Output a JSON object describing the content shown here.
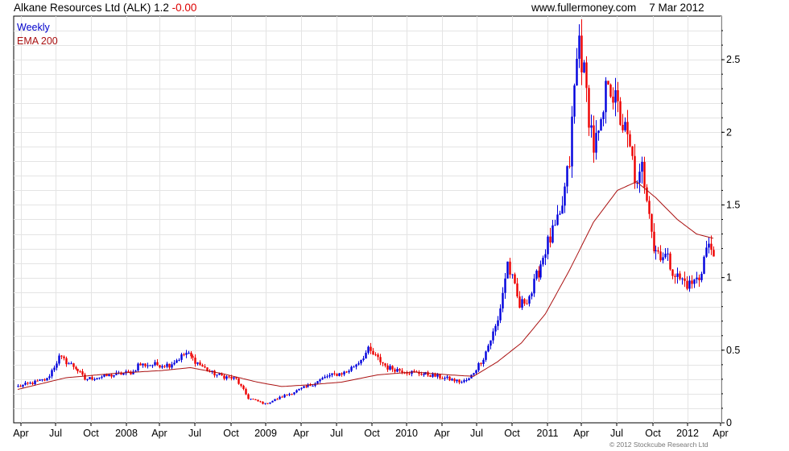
{
  "header": {
    "title": "Alkane Resources Ltd (ALK) 1.2",
    "change": "-0.00",
    "site": "www.fullermoney.com",
    "date": "7 Mar 2012"
  },
  "legend": {
    "weekly": "Weekly",
    "ema": "EMA 200"
  },
  "footer": "© 2012 Stockcube Research Ltd",
  "colors": {
    "up": "#0000dd",
    "down": "#ee0000",
    "ema": "#aa1111",
    "grid": "#e4e4e4"
  },
  "chart_data": {
    "type": "candlestick",
    "title": "Alkane Resources Ltd (ALK) 1.2 -0.00",
    "x_tick_labels": [
      "Apr",
      "Jul",
      "Oct",
      "2008",
      "Apr",
      "Jul",
      "Oct",
      "2009",
      "Apr",
      "Jul",
      "Oct",
      "2010",
      "Apr",
      "Jul",
      "Oct",
      "2011",
      "Apr",
      "Jul",
      "Oct",
      "2012",
      "Apr"
    ],
    "y_ticks": [
      0,
      0.5,
      1,
      1.5,
      2,
      2.5
    ],
    "ylim": [
      0,
      2.8
    ],
    "grid": true,
    "legend_position": "top-left",
    "series": [
      {
        "name": "Weekly",
        "anchors": [
          [
            0,
            0.25
          ],
          [
            12,
            0.3
          ],
          [
            17,
            0.45
          ],
          [
            24,
            0.38
          ],
          [
            28,
            0.3
          ],
          [
            40,
            0.33
          ],
          [
            48,
            0.35
          ],
          [
            50,
            0.4
          ],
          [
            63,
            0.4
          ],
          [
            70,
            0.48
          ],
          [
            76,
            0.4
          ],
          [
            80,
            0.35
          ],
          [
            83,
            0.33
          ],
          [
            91,
            0.3
          ],
          [
            96,
            0.17
          ],
          [
            103,
            0.13
          ],
          [
            110,
            0.18
          ],
          [
            122,
            0.26
          ],
          [
            129,
            0.32
          ],
          [
            137,
            0.35
          ],
          [
            142,
            0.42
          ],
          [
            146,
            0.5
          ],
          [
            154,
            0.38
          ],
          [
            163,
            0.35
          ],
          [
            172,
            0.33
          ],
          [
            180,
            0.3
          ],
          [
            185,
            0.28
          ],
          [
            188,
            0.3
          ],
          [
            194,
            0.45
          ],
          [
            200,
            0.7
          ],
          [
            204,
            1.1
          ],
          [
            209,
            0.8
          ],
          [
            214,
            0.9
          ],
          [
            220,
            1.2
          ],
          [
            226,
            1.4
          ],
          [
            230,
            1.8
          ],
          [
            232,
            2.3
          ],
          [
            234,
            2.65
          ],
          [
            237,
            2.25
          ],
          [
            240,
            1.9
          ],
          [
            243,
            2.0
          ],
          [
            246,
            2.4
          ],
          [
            249,
            2.2
          ],
          [
            253,
            2.0
          ],
          [
            256,
            1.8
          ],
          [
            258,
            1.6
          ],
          [
            260,
            1.75
          ],
          [
            263,
            1.5
          ],
          [
            265,
            1.2
          ],
          [
            270,
            1.15
          ],
          [
            275,
            1.0
          ],
          [
            280,
            0.95
          ],
          [
            284,
            1.0
          ],
          [
            287,
            1.2
          ],
          [
            290,
            1.2
          ]
        ]
      },
      {
        "name": "EMA 200",
        "points": [
          [
            0,
            0.23
          ],
          [
            20,
            0.31
          ],
          [
            40,
            0.34
          ],
          [
            60,
            0.36
          ],
          [
            72,
            0.38
          ],
          [
            85,
            0.34
          ],
          [
            100,
            0.28
          ],
          [
            110,
            0.25
          ],
          [
            120,
            0.26
          ],
          [
            135,
            0.28
          ],
          [
            150,
            0.33
          ],
          [
            165,
            0.35
          ],
          [
            180,
            0.33
          ],
          [
            190,
            0.32
          ],
          [
            200,
            0.42
          ],
          [
            210,
            0.55
          ],
          [
            220,
            0.75
          ],
          [
            230,
            1.05
          ],
          [
            240,
            1.38
          ],
          [
            250,
            1.6
          ],
          [
            258,
            1.66
          ],
          [
            266,
            1.55
          ],
          [
            275,
            1.4
          ],
          [
            283,
            1.3
          ],
          [
            290,
            1.27
          ]
        ]
      }
    ]
  }
}
